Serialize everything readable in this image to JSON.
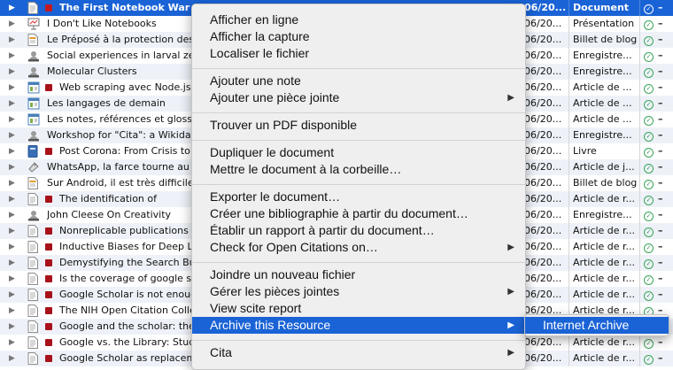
{
  "colors": {
    "selection": "#1a63d6",
    "tag_red": "#a8121a",
    "status_green": "#2e9a4a"
  },
  "rows": [
    {
      "title": "The First Notebook War",
      "date": "06/20...",
      "type": "Document",
      "icon": "document-icon",
      "tag": true,
      "selected": true
    },
    {
      "title": "I Don't Like Notebooks",
      "date": "06/20...",
      "type": "Présentation",
      "icon": "presentation-icon",
      "tag": false
    },
    {
      "title": "Le Préposé à la protection des",
      "date": "06/20...",
      "type": "Billet de blog",
      "icon": "blog-post-icon",
      "tag": false
    },
    {
      "title": "Social experiences in larval zeb",
      "date": "06/20...",
      "type": "Enregistre...",
      "icon": "recording-icon",
      "tag": false
    },
    {
      "title": "Molecular Clusters",
      "date": "06/20...",
      "type": "Enregistre...",
      "icon": "recording-icon",
      "tag": false
    },
    {
      "title": "Web scraping avec Node.js",
      "date": "06/20...",
      "type": "Article de ...",
      "icon": "web-page-icon",
      "tag": true
    },
    {
      "title": "Les langages de demain",
      "date": "06/20...",
      "type": "Article de ...",
      "icon": "web-page-icon",
      "tag": false
    },
    {
      "title": "Les notes, références et glossa",
      "date": "06/20...",
      "type": "Article de ...",
      "icon": "web-page-icon",
      "tag": false
    },
    {
      "title": "Workshop for \"Cita\": a Wikidat",
      "date": "06/20...",
      "type": "Enregistre...",
      "icon": "recording-icon",
      "tag": false
    },
    {
      "title": "Post Corona: From Crisis to",
      "date": "06/20...",
      "type": "Livre",
      "icon": "book-icon",
      "tag": true
    },
    {
      "title": "WhatsApp, la farce tourne au r",
      "date": "06/20...",
      "type": "Article de j...",
      "icon": "newspaper-article-icon",
      "tag": false
    },
    {
      "title": "Sur Android, il est très difficile",
      "date": "06/20...",
      "type": "Billet de blog",
      "icon": "blog-post-icon",
      "tag": false
    },
    {
      "title": "The identification of",
      "date": "06/20...",
      "type": "Article de r...",
      "icon": "journal-article-icon",
      "tag": true
    },
    {
      "title": "John Cleese On Creativity",
      "date": "06/20...",
      "type": "Enregistre...",
      "icon": "recording-icon",
      "tag": false
    },
    {
      "title": "Nonreplicable publications a",
      "date": "06/20...",
      "type": "Article de r...",
      "icon": "journal-article-icon",
      "tag": true
    },
    {
      "title": "Inductive Biases for Deep Le",
      "date": "06/20...",
      "type": "Article de r...",
      "icon": "journal-article-icon",
      "tag": true
    },
    {
      "title": "Demystifying the Search But",
      "date": "06/20...",
      "type": "Article de r...",
      "icon": "journal-article-icon",
      "tag": true
    },
    {
      "title": "Is the coverage of google sc",
      "date": "06/20...",
      "type": "Article de r...",
      "icon": "journal-article-icon",
      "tag": true
    },
    {
      "title": "Google Scholar is not enoug",
      "date": "06/20...",
      "type": "Article de r...",
      "icon": "journal-article-icon",
      "tag": true
    },
    {
      "title": "The NIH Open Citation Colle",
      "date": "06/20...",
      "type": "Article de r...",
      "icon": "journal-article-icon",
      "tag": true
    },
    {
      "title": "Google and the scholar: the",
      "date": "06/20...",
      "type": "Article de r...",
      "icon": "journal-article-icon",
      "tag": true
    },
    {
      "title": "Google vs. the Library: Stud",
      "date": "06/20...",
      "type": "Article de r...",
      "icon": "journal-article-icon",
      "tag": true
    },
    {
      "title": "Google Scholar as replaceme",
      "date": "06/20...",
      "type": "Article de r...",
      "icon": "journal-article-icon",
      "tag": true
    }
  ],
  "context_menu": {
    "items": [
      {
        "label": "Afficher en ligne"
      },
      {
        "label": "Afficher la capture"
      },
      {
        "label": "Localiser le fichier"
      },
      {
        "label": "Ajouter une note"
      },
      {
        "label": "Ajouter une pièce jointe",
        "submenu": true
      },
      {
        "label": "Trouver un PDF disponible"
      },
      {
        "label": "Dupliquer le document"
      },
      {
        "label": "Mettre le document à la corbeille…"
      },
      {
        "label": "Exporter le document…"
      },
      {
        "label": "Créer une bibliographie à partir du document…"
      },
      {
        "label": "Établir un rapport à partir du document…"
      },
      {
        "label": "Check for Open Citations on…",
        "submenu": true
      },
      {
        "label": "Joindre un nouveau fichier"
      },
      {
        "label": "Gérer les pièces jointes",
        "submenu": true
      },
      {
        "label": "View scite report"
      },
      {
        "label": "Archive this Resource",
        "submenu": true,
        "highlighted": true
      },
      {
        "label": "Cita",
        "submenu": true
      }
    ]
  },
  "submenu": {
    "items": [
      {
        "label": "Internet Archive"
      }
    ]
  }
}
